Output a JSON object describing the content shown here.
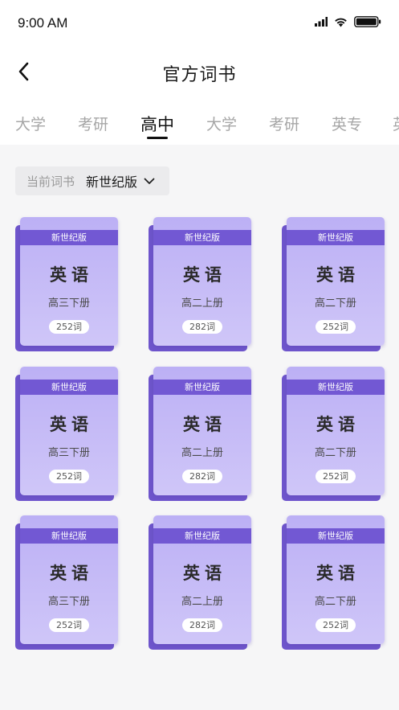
{
  "status": {
    "time": "9:00 AM"
  },
  "header": {
    "title": "官方词书"
  },
  "tabs": [
    {
      "label": "大学"
    },
    {
      "label": "考研"
    },
    {
      "label": "高中",
      "active": true
    },
    {
      "label": "大学"
    },
    {
      "label": "考研"
    },
    {
      "label": "英专"
    },
    {
      "label": "英"
    }
  ],
  "filter": {
    "label": "当前词书",
    "value": "新世纪版"
  },
  "books": [
    {
      "edition": "新世纪版",
      "subject": "英语",
      "grade": "高三下册",
      "count": "252词"
    },
    {
      "edition": "新世纪版",
      "subject": "英语",
      "grade": "高二上册",
      "count": "282词"
    },
    {
      "edition": "新世纪版",
      "subject": "英语",
      "grade": "高二下册",
      "count": "252词"
    },
    {
      "edition": "新世纪版",
      "subject": "英语",
      "grade": "高三下册",
      "count": "252词"
    },
    {
      "edition": "新世纪版",
      "subject": "英语",
      "grade": "高二上册",
      "count": "282词"
    },
    {
      "edition": "新世纪版",
      "subject": "英语",
      "grade": "高二下册",
      "count": "252词"
    },
    {
      "edition": "新世纪版",
      "subject": "英语",
      "grade": "高三下册",
      "count": "252词"
    },
    {
      "edition": "新世纪版",
      "subject": "英语",
      "grade": "高二上册",
      "count": "282词"
    },
    {
      "edition": "新世纪版",
      "subject": "英语",
      "grade": "高二下册",
      "count": "252词"
    }
  ],
  "icons": {
    "signal": "signal-icon",
    "wifi": "wifi-icon",
    "battery": "battery-icon",
    "back": "back-arrow-icon",
    "dropdown": "chevron-down-icon"
  },
  "colors": {
    "accent": "#7258d3",
    "cover": "#c6bbf6",
    "spine": "#6e55cc"
  }
}
